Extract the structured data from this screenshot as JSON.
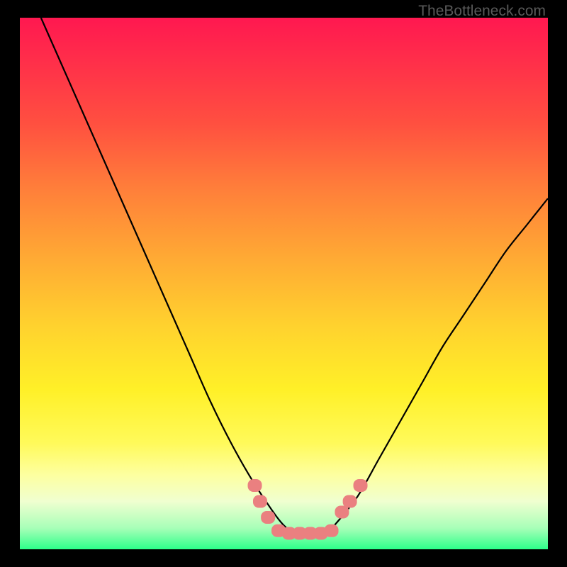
{
  "watermark": "TheBottleneck.com",
  "chart_data": {
    "type": "line",
    "title": "",
    "xlabel": "",
    "ylabel": "",
    "xlim": [
      0,
      100
    ],
    "ylim": [
      0,
      100
    ],
    "series": [
      {
        "name": "bottleneck-curve",
        "x": [
          4,
          8,
          12,
          16,
          20,
          24,
          28,
          32,
          36,
          40,
          44,
          48,
          50,
          52,
          54,
          56,
          58,
          60,
          64,
          68,
          72,
          76,
          80,
          84,
          88,
          92,
          96,
          100
        ],
        "y": [
          100,
          91,
          82,
          73,
          64,
          55,
          46,
          37,
          28,
          20,
          13,
          7,
          4.5,
          3,
          2.5,
          2.5,
          3,
          5,
          10,
          17,
          24,
          31,
          38,
          44,
          50,
          56,
          61,
          66
        ]
      }
    ],
    "markers": {
      "name": "highlight-points",
      "color": "#ea8080",
      "points": [
        {
          "x": 44.5,
          "y": 12
        },
        {
          "x": 45.5,
          "y": 9
        },
        {
          "x": 47,
          "y": 6
        },
        {
          "x": 49,
          "y": 3.5
        },
        {
          "x": 51,
          "y": 3
        },
        {
          "x": 53,
          "y": 3
        },
        {
          "x": 55,
          "y": 3
        },
        {
          "x": 57,
          "y": 3
        },
        {
          "x": 59,
          "y": 3.5
        },
        {
          "x": 61,
          "y": 7
        },
        {
          "x": 62.5,
          "y": 9
        },
        {
          "x": 64.5,
          "y": 12
        }
      ]
    }
  }
}
